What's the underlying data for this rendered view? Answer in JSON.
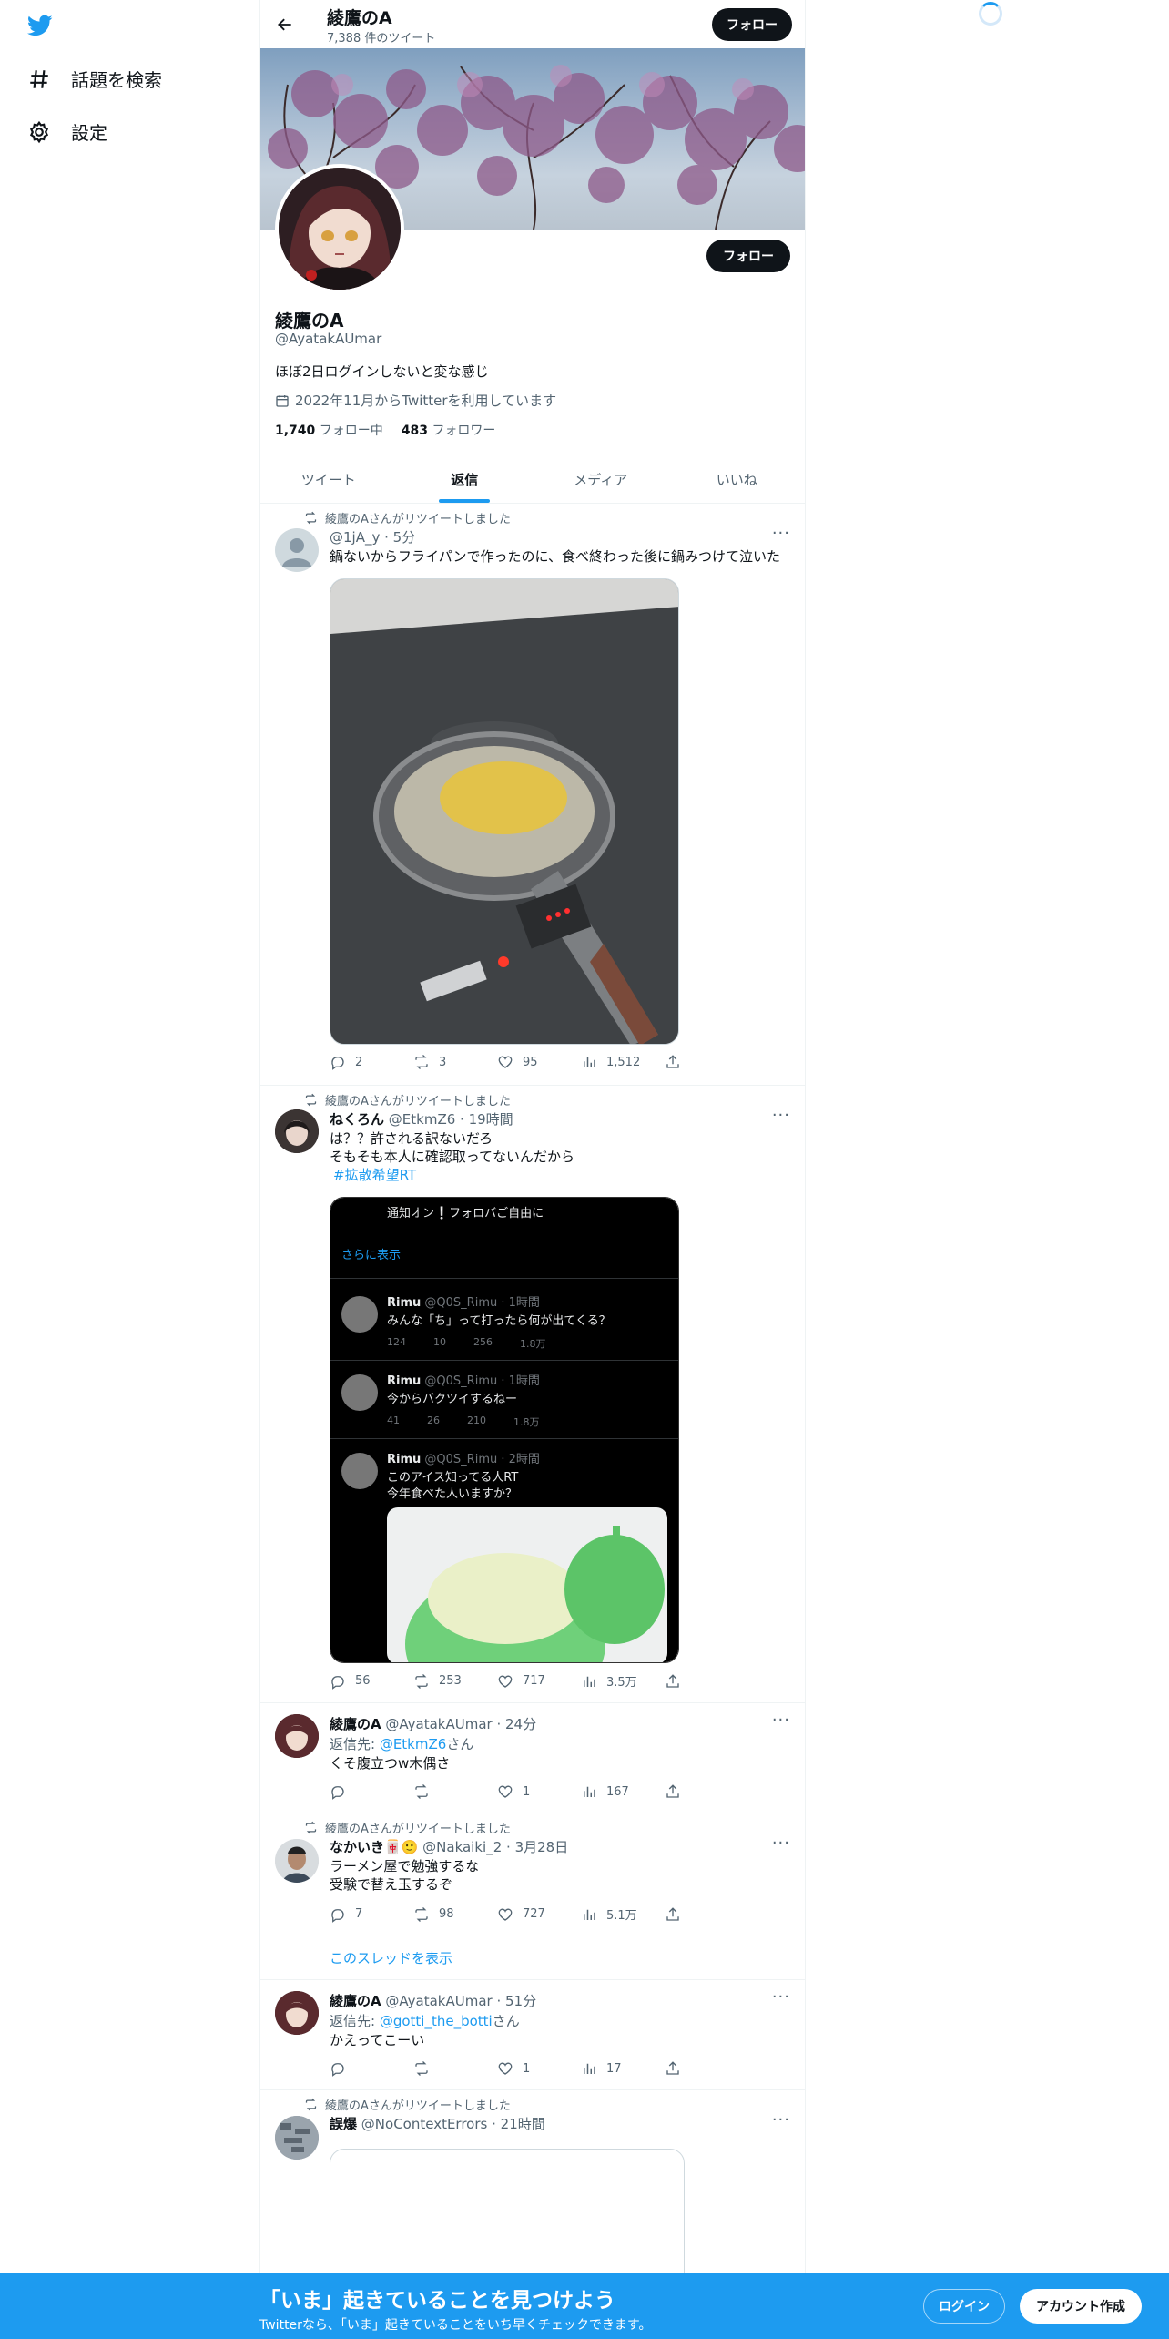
{
  "nav": {
    "explore_label": "話題を検索",
    "settings_label": "設定"
  },
  "header": {
    "name": "綾鷹のA",
    "tweet_count": "7,388 件のツイート",
    "follow_label": "フォロー"
  },
  "profile": {
    "name": "綾鷹のA",
    "handle": "@AyatakAUmar",
    "bio": "ほぼ2日ログインしないと変な感じ",
    "joined": "2022年11月からTwitterを利用しています",
    "following_count": "1,740",
    "following_label": "フォロー中",
    "followers_count": "483",
    "followers_label": "フォロワー",
    "follow_label": "フォロー"
  },
  "tabs": [
    {
      "label": "ツイート",
      "active": false
    },
    {
      "label": "返信",
      "active": true
    },
    {
      "label": "メディア",
      "active": false
    },
    {
      "label": "いいね",
      "active": false
    }
  ],
  "tweets": [
    {
      "retweeted_by": "綾鷹のAさんがリツイートしました",
      "name": "",
      "handle": "@1jA_y",
      "time": "5分",
      "text": "鍋ないからフライパンで作ったのに、食べ終わった後に鍋みつけて泣いた",
      "replies": "2",
      "retweets": "3",
      "likes": "95",
      "views": "1,512"
    },
    {
      "retweeted_by": "綾鷹のAさんがリツイートしました",
      "name": "ねくろん",
      "handle": "@EtkmZ6",
      "time": "19時間",
      "text_line1": "は？？許される訳ないだろ",
      "text_line2": "そもそも本人に確認取ってないんだから",
      "hashtag": "#拡散希望RT",
      "replies": "56",
      "retweets": "253",
      "likes": "717",
      "views": "3.5万",
      "embed": {
        "top_text": "通知オン❕フォロバご自由に",
        "show_more": "さらに表示",
        "posts": [
          {
            "name": "Rimu",
            "handle": "@Q0S_Rimu",
            "time": "1時間",
            "text": "みんな「ち」って打ったら何が出てくる？",
            "r": "124",
            "rt": "10",
            "l": "256",
            "v": "1.8万"
          },
          {
            "name": "Rimu",
            "handle": "@Q0S_Rimu",
            "time": "1時間",
            "text": "今からバクツイするねー",
            "r": "41",
            "rt": "26",
            "l": "210",
            "v": "1.8万"
          },
          {
            "name": "Rimu",
            "handle": "@Q0S_Rimu",
            "time": "2時間",
            "text": "このアイス知ってる人RT",
            "text2": "今年食べた人いますか？"
          }
        ]
      }
    },
    {
      "retweeted_by": "",
      "name": "綾鷹のA",
      "handle": "@AyatakAUmar",
      "time": "24分",
      "reply_prefix": "返信先: ",
      "reply_to": "@EtkmZ6",
      "reply_suffix": "さん",
      "text": "くそ腹立つw木偶さ",
      "replies": "",
      "retweets": "",
      "likes": "1",
      "views": "167"
    },
    {
      "retweeted_by": "綾鷹のAさんがリツイートしました",
      "name": "なかいき",
      "name_emoji": "🀄🙂",
      "handle": "@Nakaiki_2",
      "time": "3月28日",
      "text_line1": "ラーメン屋で勉強するな",
      "text_line2": "受験で替え玉するぞ",
      "replies": "7",
      "retweets": "98",
      "likes": "727",
      "views": "5.1万",
      "thread_label": "このスレッドを表示"
    },
    {
      "retweeted_by": "",
      "name": "綾鷹のA",
      "handle": "@AyatakAUmar",
      "time": "51分",
      "reply_prefix": "返信先: ",
      "reply_to": "@gotti_the_botti",
      "reply_suffix": "さん",
      "text": "かえってこーい",
      "replies": "",
      "retweets": "",
      "likes": "1",
      "views": "17"
    },
    {
      "retweeted_by": "綾鷹のAさんがリツイートしました",
      "name": "誤爆",
      "handle": "@NoContextErrors",
      "time": "21時間"
    }
  ],
  "bottom_bar": {
    "title": "「いま」起きていることを見つけよう",
    "subtitle": "Twitterなら、「いま」起きていることをいち早くチェックできます。",
    "login_label": "ログイン",
    "signup_label": "アカウント作成"
  },
  "colors": {
    "accent": "#1d9bf0",
    "text": "#0f1419",
    "muted": "#536471"
  }
}
